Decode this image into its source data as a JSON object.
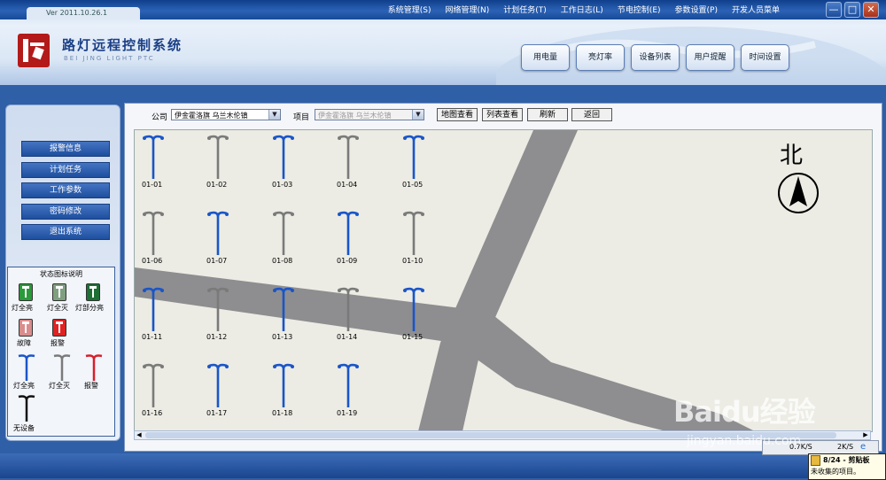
{
  "window": {
    "version": "Ver 2011.10.26.1",
    "menu": [
      "系统管理(S)",
      "网络管理(N)",
      "计划任务(T)",
      "工作日志(L)",
      "节电控制(E)",
      "参数设置(P)",
      "开发人员菜单"
    ],
    "controls": [
      "—",
      "□",
      "✕"
    ]
  },
  "app": {
    "title": "路灯远程控制系统",
    "subtitle": "BEI JING LIGHT PTC"
  },
  "top_buttons": [
    "用电量",
    "亮灯率",
    "设备列表",
    "用户提醒",
    "时间设置"
  ],
  "sidebar": {
    "items": [
      "报警信息",
      "计划任务",
      "工作参数",
      "密码修改",
      "退出系统"
    ]
  },
  "legend": {
    "title": "状态图标说明",
    "switches": [
      {
        "label": "灯全亮",
        "color": "#2a9a3a"
      },
      {
        "label": "灯全灭",
        "color": "#7fa080"
      },
      {
        "label": "灯部分亮",
        "color": "#1d6f35"
      },
      {
        "label": "故障",
        "color": "#d98d8d"
      },
      {
        "label": "报警",
        "color": "#e02222"
      }
    ],
    "poles": [
      {
        "label": "灯全亮",
        "color": "#1a55c8"
      },
      {
        "label": "灯全灭",
        "color": "#7a7a7a"
      },
      {
        "label": "报警",
        "color": "#d81e2a"
      },
      {
        "label": "无设备",
        "color": "#111111"
      }
    ]
  },
  "toolbar": {
    "company_label": "公司",
    "company_value": "伊金霍洛旗 乌兰木伦镇",
    "project_label": "项目",
    "project_value": "伊金霍洛旗 乌兰木伦镇",
    "buttons": [
      "地图查看",
      "列表查看",
      "刷新",
      "返回"
    ]
  },
  "map": {
    "north_label": "北",
    "lamps": [
      {
        "id": "01-01",
        "on": true
      },
      {
        "id": "01-02",
        "on": false
      },
      {
        "id": "01-03",
        "on": true
      },
      {
        "id": "01-04",
        "on": false
      },
      {
        "id": "01-05",
        "on": true
      },
      {
        "id": "01-06",
        "on": false
      },
      {
        "id": "01-07",
        "on": true
      },
      {
        "id": "01-08",
        "on": false
      },
      {
        "id": "01-09",
        "on": true
      },
      {
        "id": "01-10",
        "on": false
      },
      {
        "id": "01-11",
        "on": true
      },
      {
        "id": "01-12",
        "on": false
      },
      {
        "id": "01-13",
        "on": true
      },
      {
        "id": "01-14",
        "on": false
      },
      {
        "id": "01-15",
        "on": true
      },
      {
        "id": "01-16",
        "on": false
      },
      {
        "id": "01-17",
        "on": true
      },
      {
        "id": "01-18",
        "on": true
      },
      {
        "id": "01-19",
        "on": true
      }
    ]
  },
  "tray": {
    "speed1": "0.7K/S",
    "speed2": "2K/S",
    "clipboard_title": "8/24 - 剪贴板",
    "clipboard_text": "未收集的项目。"
  },
  "watermark": {
    "brand": "Baidu经验",
    "url": "jingyan.baidu.com"
  },
  "colors": {
    "lamp_on": "#1a55c8",
    "lamp_off": "#7a7a7a",
    "road": "#8e8e90"
  }
}
